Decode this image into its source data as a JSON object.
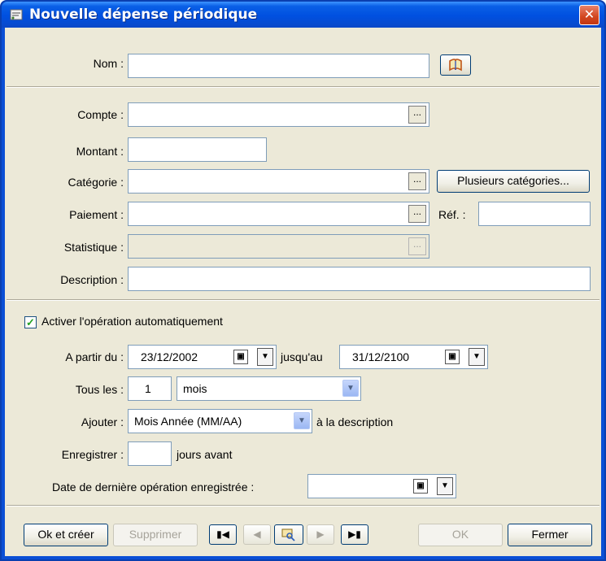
{
  "window": {
    "title": "Nouvelle dépense périodique",
    "close_glyph": "✕"
  },
  "name_section": {
    "label": "Nom :",
    "value": ""
  },
  "details": {
    "account_label": "Compte :",
    "amount_label": "Montant :",
    "category_label": "Catégorie :",
    "multi_category_button": "Plusieurs catégories...",
    "payment_label": "Paiement :",
    "ref_label": "Réf. :",
    "statistic_label": "Statistique :",
    "description_label": "Description :",
    "browse_label": "..."
  },
  "automation": {
    "activate_label": "Activer l'opération automatiquement",
    "activate_checked": true,
    "from_label": "A partir du :",
    "from_date": "23/12/2002",
    "until_label": "jusqu'au",
    "until_date": "31/12/2100",
    "every_label": "Tous les :",
    "every_value": "1",
    "every_unit": "mois",
    "add_label": "Ajouter :",
    "add_value": "Mois Année (MM/AA)",
    "add_suffix": "à la description",
    "record_label": "Enregistrer :",
    "record_value": "",
    "record_suffix": "jours avant",
    "last_date_label": "Date de dernière opération enregistrée :",
    "last_date_value": ""
  },
  "footer": {
    "ok_create": "Ok et créer",
    "delete": "Supprimer",
    "ok": "OK",
    "close": "Fermer"
  },
  "icons": {
    "title": "recurring-expense-icon",
    "name_picker": "book-icon",
    "calendar": "calendar-icon",
    "nav_first": "first-record-icon",
    "nav_prev": "previous-record-icon",
    "nav_search": "search-icon",
    "nav_next": "next-record-icon",
    "nav_last": "last-record-icon"
  },
  "colors": {
    "titlebar": "#0a5fe6",
    "client": "#ece9d8",
    "close": "#d2461f",
    "check": "#21a121"
  }
}
